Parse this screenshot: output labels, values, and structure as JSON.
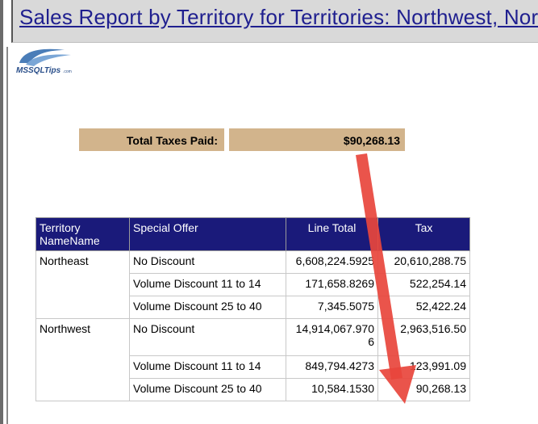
{
  "title": "Sales Report by Territory for Territories: Northwest, Northeast",
  "logo": {
    "text": "MSSQLTips",
    "suffix": ".com"
  },
  "totals": {
    "label": "Total Taxes Paid:",
    "value": "$90,268.13"
  },
  "table": {
    "headers": [
      "Territory NameName",
      "Special Offer",
      "Line Total",
      "Tax"
    ],
    "groups": [
      {
        "territory": "Northeast",
        "rows": [
          {
            "offer": "No Discount",
            "line_total": "6,608,224.5925",
            "tax": "20,610,288.75"
          },
          {
            "offer": "Volume Discount 11 to 14",
            "line_total": "171,658.8269",
            "tax": "522,254.14"
          },
          {
            "offer": "Volume Discount 25 to 40",
            "line_total": "7,345.5075",
            "tax": "52,422.24"
          }
        ]
      },
      {
        "territory": "Northwest",
        "rows": [
          {
            "offer": "No Discount",
            "line_total": "14,914,067.9706",
            "tax": "2,963,516.50"
          },
          {
            "offer": "Volume Discount 11 to 14",
            "line_total": "849,794.4273",
            "tax": "123,991.09"
          },
          {
            "offer": "Volume Discount 25 to 40",
            "line_total": "10,584.1530",
            "tax": "90,268.13"
          }
        ]
      }
    ]
  },
  "colors": {
    "header_bg": "#1a1a7a",
    "totals_bg": "#d2b48c",
    "arrow": "#e8453c",
    "link": "#1f1f8f"
  }
}
